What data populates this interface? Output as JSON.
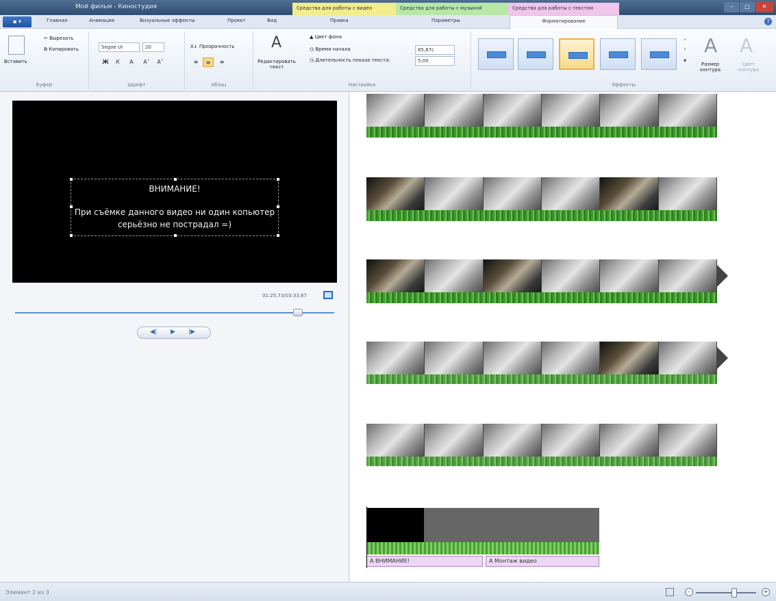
{
  "window": {
    "title": "Мой фильм - Киностудия",
    "context_tabs": {
      "video": "Средства для работы с видео",
      "music": "Средства для работы с музыкой",
      "text": "Средства для работы с текстом"
    },
    "buttons": {
      "minimize": "–",
      "maximize": "□",
      "close": "✕"
    }
  },
  "ribbon": {
    "file_button": "▪ ▾",
    "tabs": [
      "Главная",
      "Анимация",
      "Визуальные эффекты",
      "Проект",
      "Вид",
      "Правка",
      "Параметры",
      "Форматирование"
    ],
    "active_tab": "Форматирование",
    "clipboard": {
      "paste": "Вставить",
      "cut": "Вырезать",
      "copy": "Копировать",
      "group": "Буфер"
    },
    "font": {
      "family": "Segoe UI",
      "size": "20",
      "bold": "Ж",
      "italic": "К",
      "color": "A",
      "grow": "A˄",
      "shrink": "A˅",
      "group": "Шрифт"
    },
    "paragraph": {
      "transparency": "Прозрачность",
      "group": "Абзац"
    },
    "settings": {
      "edit_text": "Редактировать текст",
      "bg_color": "Цвет фона",
      "start_time_label": "Время начала",
      "start_time_value": "85,87с",
      "duration_label": "Длительность показа текста:",
      "duration_value": "5,00",
      "group": "Настройка"
    },
    "effects": {
      "group": "Эффекты",
      "outline_size": "Размер контура",
      "outline_color": "Цвет контура"
    }
  },
  "preview": {
    "caption_line1": "ВНИМАНИЕ!",
    "caption_line2": "При съёмке данного видео ни один копьютер",
    "caption_line3": "серьёзно не пострадал =)",
    "timecode": "01:25,73/03:33,67",
    "playback": {
      "prev": "◀|",
      "play": "▶",
      "next": "|▶"
    }
  },
  "timeline": {
    "text_clip_1": "A ВНИМАНИЕ!",
    "text_clip_2": "A Монтаж видео"
  },
  "status": {
    "text": "Элемент 2 из 3",
    "zoom_out": "–",
    "zoom_in": "+"
  }
}
